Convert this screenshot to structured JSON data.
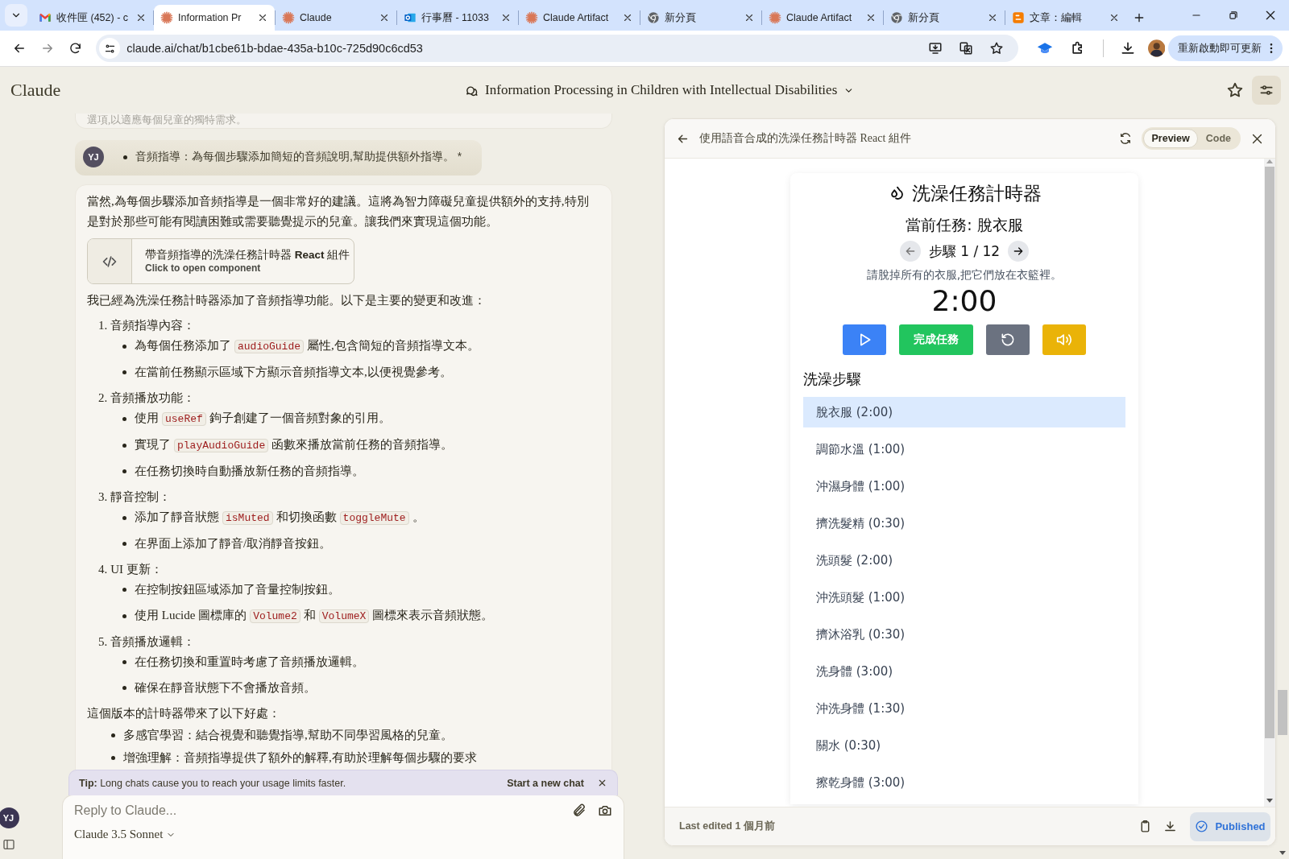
{
  "browser": {
    "tabs": [
      {
        "kind": "mail",
        "title": "收件匣 (452) - c",
        "selected": false
      },
      {
        "kind": "assistant",
        "title": "Information Pr",
        "selected": true
      },
      {
        "kind": "assistant",
        "title": "Claude",
        "selected": false
      },
      {
        "kind": "calendar",
        "title": "行事曆 - 11033",
        "selected": false
      },
      {
        "kind": "assistant",
        "title": "Claude Artifact",
        "selected": false
      },
      {
        "kind": "newtab",
        "title": "新分頁",
        "selected": false
      },
      {
        "kind": "assistant",
        "title": "Claude Artifact",
        "selected": false
      },
      {
        "kind": "newtab",
        "title": "新分頁",
        "selected": false
      },
      {
        "kind": "blog",
        "title": "文章：編輯",
        "selected": false
      }
    ],
    "url": "claude.ai/chat/b1cbe61b-bdae-435a-b10c-725d90c6cd53",
    "update_button": "重新啟動即可更新"
  },
  "app": {
    "logo": "Claude",
    "conversation_title": "Information Processing in Children with Intellectual Disabilities"
  },
  "chat": {
    "faded_text": "選項,以適應每個兒童的獨特需求。",
    "user_message": {
      "avatar": "YJ",
      "text": "音頻指導：為每個步驟添加簡短的音頻說明,幫助提供額外指導。 *"
    },
    "intro": "當然,為每個步驟添加音頻指導是一個非常好的建議。這將為智力障礙兒童提供額外的支持,特別是對於那些可能有閱讀困難或需要聽覺提示的兒童。讓我們來實現這個功能。",
    "artifact": {
      "title": "帶音頻指導的洗澡任務計時器 **React** 組件",
      "subtitle": "Click to open component"
    },
    "lead": "我已經為洗澡任務計時器添加了音頻指導功能。以下是主要的變更和改進：",
    "sections": [
      {
        "number": "1.",
        "heading": "音頻指導內容：",
        "bullets": [
          [
            {
              "kind": "text",
              "text": "為每個任務添加了"
            },
            {
              "kind": "code",
              "text": "audioGuide"
            },
            {
              "kind": "text",
              "text": "屬性,包含簡短的音頻指導文本。"
            }
          ],
          [
            {
              "kind": "text",
              "text": "在當前任務顯示區域下方顯示音頻指導文本,以便視覺參考。"
            }
          ]
        ]
      },
      {
        "number": "2.",
        "heading": "音頻播放功能：",
        "bullets": [
          [
            {
              "kind": "text",
              "text": "使用"
            },
            {
              "kind": "code",
              "text": "useRef"
            },
            {
              "kind": "text",
              "text": "鉤子創建了一個音頻對象的引用。"
            }
          ],
          [
            {
              "kind": "text",
              "text": "實現了"
            },
            {
              "kind": "code",
              "text": "playAudioGuide"
            },
            {
              "kind": "text",
              "text": "函數來播放當前任務的音頻指導。"
            }
          ],
          [
            {
              "kind": "text",
              "text": "在任務切換時自動播放新任務的音頻指導。"
            }
          ]
        ]
      },
      {
        "number": "3.",
        "heading": "靜音控制：",
        "bullets": [
          [
            {
              "kind": "text",
              "text": "添加了靜音狀態"
            },
            {
              "kind": "code",
              "text": "isMuted"
            },
            {
              "kind": "text",
              "text": "和切換函數"
            },
            {
              "kind": "code",
              "text": "toggleMute"
            },
            {
              "kind": "text",
              "text": "。"
            }
          ],
          [
            {
              "kind": "text",
              "text": "在界面上添加了靜音/取消靜音按鈕。"
            }
          ]
        ]
      },
      {
        "number": "4.",
        "heading": "UI 更新：",
        "bullets": [
          [
            {
              "kind": "text",
              "text": "在控制按鈕區域添加了音量控制按鈕。"
            }
          ],
          [
            {
              "kind": "text",
              "text": "使用 Lucide 圖標庫的"
            },
            {
              "kind": "code",
              "text": "Volume2"
            },
            {
              "kind": "text",
              "text": "和"
            },
            {
              "kind": "code",
              "text": "VolumeX"
            },
            {
              "kind": "text",
              "text": "圖標來表示音頻狀態。"
            }
          ]
        ]
      },
      {
        "number": "5.",
        "heading": "音頻播放邏輯：",
        "bullets": [
          [
            {
              "kind": "text",
              "text": "在任務切換和重置時考慮了音頻播放邏輯。"
            }
          ],
          [
            {
              "kind": "text",
              "text": "確保在靜音狀態下不會播放音頻。"
            }
          ]
        ]
      }
    ],
    "benefits_lead": "這個版本的計時器帶來了以下好處：",
    "benefits": [
      "多感官學習：結合視覺和聽覺指導,幫助不同學習風格的兒童。",
      "增強理解：音頻指導提供了額外的解釋,有助於理解每個步驟的要求"
    ]
  },
  "tip": {
    "label": "Tip:",
    "text": "Long chats cause you to reach your usage limits faster.",
    "action": "Start a new chat"
  },
  "composer": {
    "placeholder": "Reply to Claude...",
    "model": "Claude 3.5 Sonnet"
  },
  "account_avatar": "YJ",
  "artifact_panel": {
    "title": "使用語音合成的洗澡任務計時器 React 組件",
    "tabs": [
      {
        "label": "Preview",
        "selected": true
      },
      {
        "label": "Code",
        "selected": false
      }
    ],
    "timer": {
      "title": "洗澡任務計時器",
      "current_task": "當前任務: 脫衣服",
      "step": "步驟 1 / 12",
      "instruction": "請脫掉所有的衣服,把它們放在衣籃裡。",
      "time": "2:00",
      "buttons": [
        {
          "kind": "play"
        },
        {
          "kind": "complete",
          "label": "完成任務"
        },
        {
          "kind": "reset"
        },
        {
          "kind": "sound"
        }
      ],
      "steps_heading": "洗澡步驟",
      "steps": [
        {
          "label": "脫衣服 (2:00)",
          "selected": true
        },
        {
          "label": "調節水溫 (1:00)",
          "selected": false
        },
        {
          "label": "沖濕身體 (1:00)",
          "selected": false
        },
        {
          "label": "擠洗髮精 (0:30)",
          "selected": false
        },
        {
          "label": "洗頭髮 (2:00)",
          "selected": false
        },
        {
          "label": "沖洗頭髮 (1:00)",
          "selected": false
        },
        {
          "label": "擠沐浴乳 (0:30)",
          "selected": false
        },
        {
          "label": "洗身體 (3:00)",
          "selected": false
        },
        {
          "label": "沖洗身體 (1:30)",
          "selected": false
        },
        {
          "label": "關水 (0:30)",
          "selected": false
        },
        {
          "label": "擦乾身體 (3:00)",
          "selected": false
        }
      ]
    },
    "footer": {
      "last_edited": "Last edited 1 個月前",
      "published": "Published"
    }
  }
}
